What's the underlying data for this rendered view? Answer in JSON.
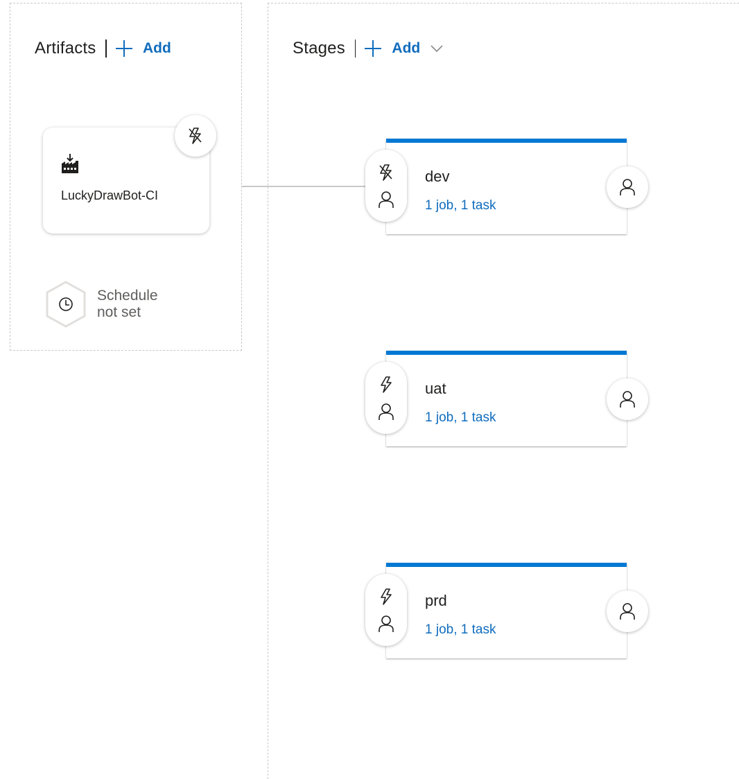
{
  "artifacts": {
    "title": "Artifacts",
    "add_label": "Add",
    "items": [
      {
        "name": "LuckyDrawBot-CI",
        "trigger_icon": "continuous-deployment-trigger-icon",
        "type_icon": "build-icon"
      }
    ],
    "schedule": {
      "line1": "Schedule",
      "line2": "not set",
      "icon": "clock-icon"
    }
  },
  "stages": {
    "title": "Stages",
    "add_label": "Add",
    "items": [
      {
        "name": "dev",
        "summary": "1 job, 1 task",
        "trigger": "after-release"
      },
      {
        "name": "uat",
        "summary": "1 job, 1 task",
        "trigger": "after-stage"
      },
      {
        "name": "prd",
        "summary": "1 job, 1 task",
        "trigger": "after-stage"
      }
    ]
  },
  "colors": {
    "accent": "#0078d4",
    "link": "#0f6cbd",
    "border": "#c8c8c8"
  }
}
